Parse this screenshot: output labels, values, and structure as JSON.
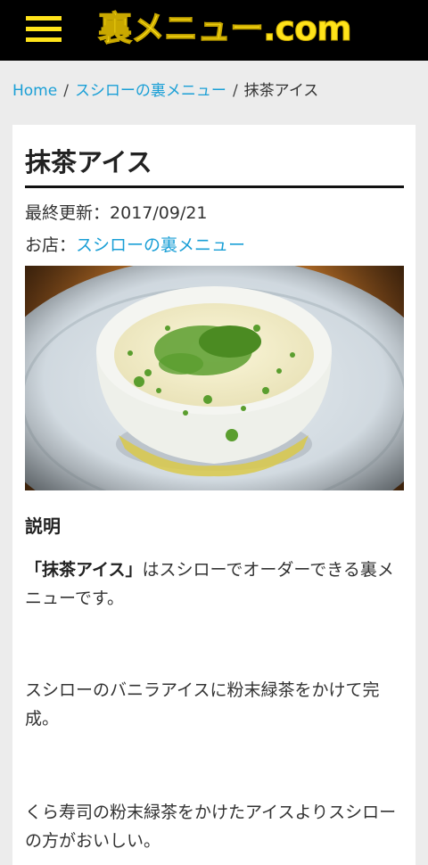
{
  "header": {
    "logo_text": "裏メニュー.com",
    "menu_icon": "hamburger-menu-icon",
    "accent_color": "#ffe31a",
    "background_color": "#000000"
  },
  "breadcrumb": {
    "home": "Home",
    "category": "スシローの裏メニュー",
    "current": "抹茶アイス",
    "separator": "/"
  },
  "article": {
    "title": "抹茶アイス",
    "updated_label": "最終更新：",
    "updated_date": "2017/09/21",
    "shop_label": "お店：",
    "shop_link": "スシローの裏メニュー",
    "image_subject": "matcha-ice-cream-photo",
    "section_heading": "説明",
    "para1_bold": "「抹茶アイス」",
    "para1_rest": "はスシローでオーダーできる裏メニューです。",
    "para2": "スシローのバニラアイスに粉末緑茶をかけて完成。",
    "para3": "くら寿司の粉末緑茶をかけたアイスよりスシローの方がおいしい。"
  },
  "colors": {
    "link": "#1a9fd6",
    "page_background": "#ececec",
    "card_background": "#ffffff"
  }
}
